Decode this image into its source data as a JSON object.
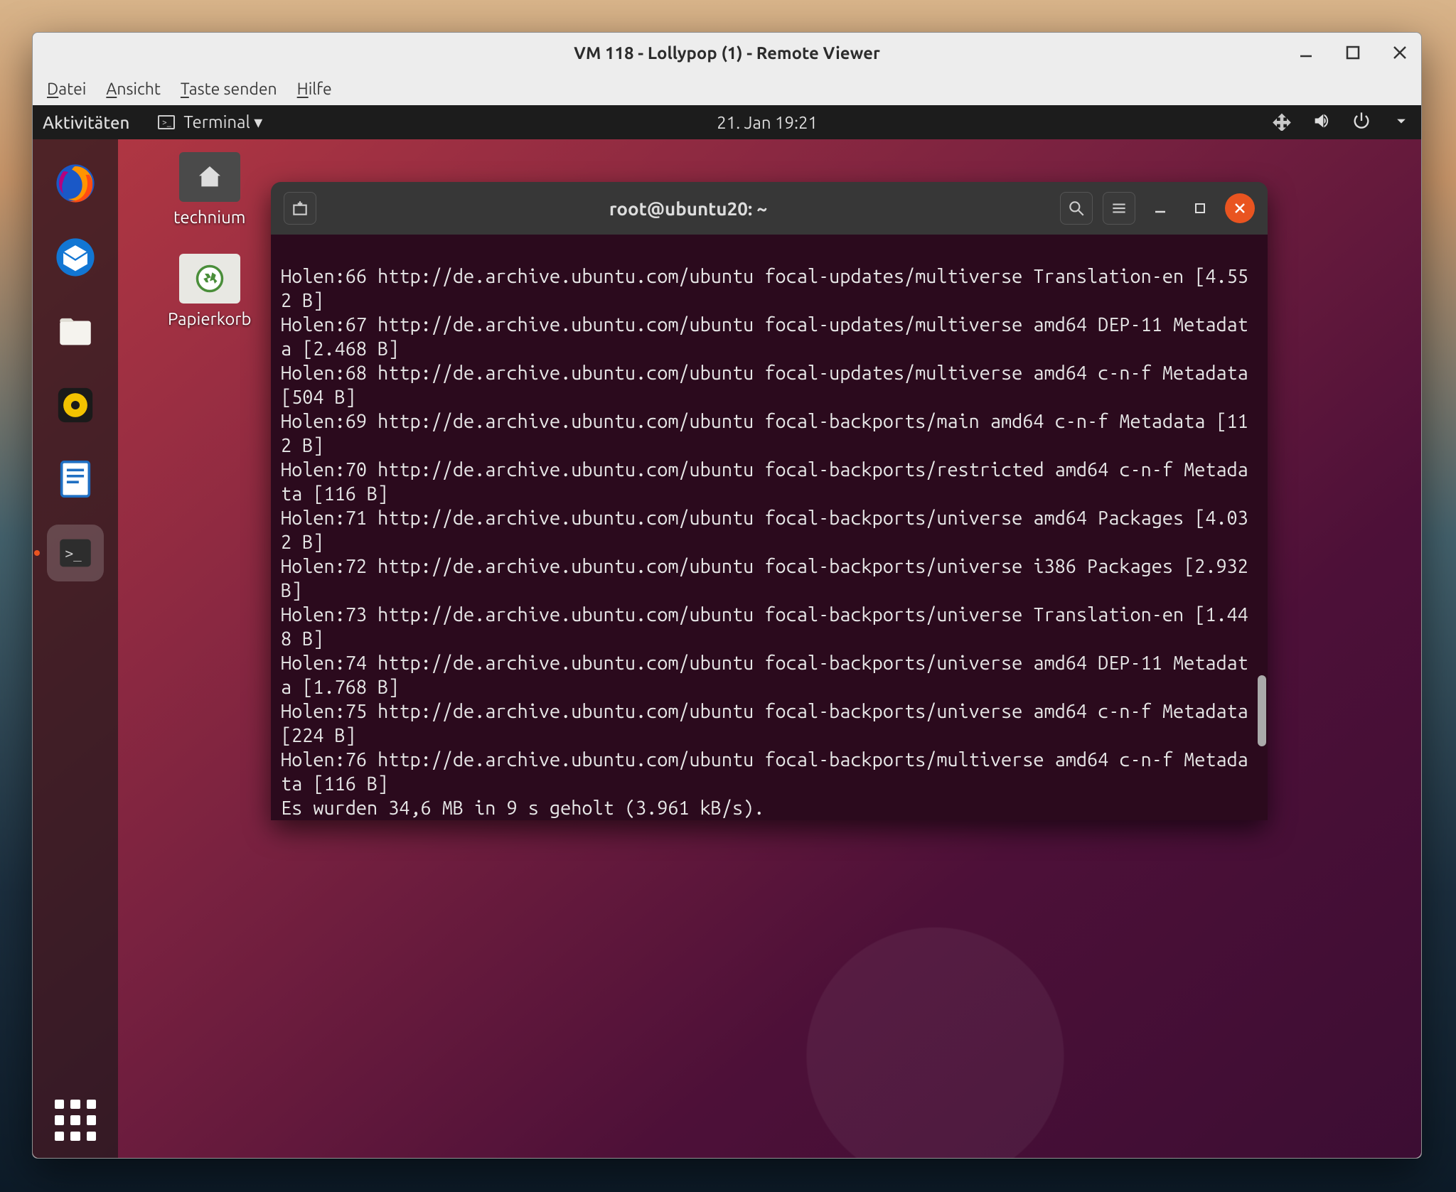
{
  "remote_viewer": {
    "title": "VM 118 - Lollypop (1) - Remote Viewer",
    "menu": {
      "file": {
        "u": "D",
        "rest": "atei"
      },
      "view": {
        "u": "A",
        "rest": "nsicht"
      },
      "send_keys": {
        "u": "T",
        "rest": "aste senden"
      },
      "help": {
        "u": "H",
        "rest": "ilfe"
      }
    }
  },
  "topbar": {
    "activities": "Aktivitäten",
    "app": "Terminal ▾",
    "clock": "21. Jan  19:21"
  },
  "desktop": {
    "home_folder": "technium",
    "trash": "Papierkorb"
  },
  "terminal": {
    "title": "root@ubuntu20: ~",
    "lines": [
      "Holen:66 http://de.archive.ubuntu.com/ubuntu focal-updates/multiverse Translation-en [4.552 B]",
      "Holen:67 http://de.archive.ubuntu.com/ubuntu focal-updates/multiverse amd64 DEP-11 Metadata [2.468 B]",
      "Holen:68 http://de.archive.ubuntu.com/ubuntu focal-updates/multiverse amd64 c-n-f Metadata [504 B]",
      "Holen:69 http://de.archive.ubuntu.com/ubuntu focal-backports/main amd64 c-n-f Metadata [112 B]",
      "Holen:70 http://de.archive.ubuntu.com/ubuntu focal-backports/restricted amd64 c-n-f Metadata [116 B]",
      "Holen:71 http://de.archive.ubuntu.com/ubuntu focal-backports/universe amd64 Packages [4.032 B]",
      "Holen:72 http://de.archive.ubuntu.com/ubuntu focal-backports/universe i386 Packages [2.932 B]",
      "Holen:73 http://de.archive.ubuntu.com/ubuntu focal-backports/universe Translation-en [1.448 B]",
      "Holen:74 http://de.archive.ubuntu.com/ubuntu focal-backports/universe amd64 DEP-11 Metadata [1.768 B]",
      "Holen:75 http://de.archive.ubuntu.com/ubuntu focal-backports/universe amd64 c-n-f Metadata [224 B]",
      "Holen:76 http://de.archive.ubuntu.com/ubuntu focal-backports/multiverse amd64 c-n-f Metadata [116 B]",
      "Es wurden 34,6 MB in 9 s geholt (3.961 kB/s)."
    ]
  }
}
